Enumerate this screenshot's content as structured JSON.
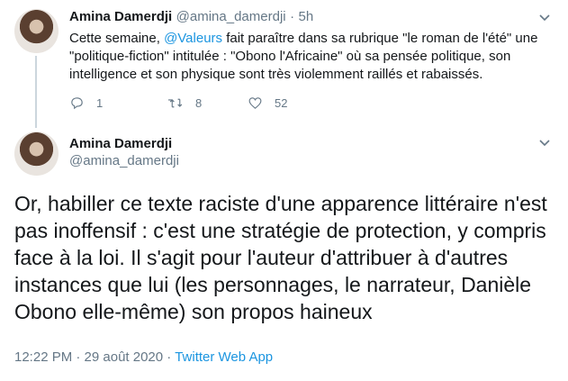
{
  "tweet1": {
    "display_name": "Amina Damerdji",
    "handle": "@amina_damerdji",
    "separator": "·",
    "time": "5h",
    "text_before": "Cette semaine, ",
    "mention": "@Valeurs",
    "text_after": " fait paraître dans sa rubrique \"le roman de l'été\" une \"politique-fiction\" intitulée : \"Obono l'Africaine\" où sa pensée politique, son intelligence et son physique sont très violemment raillés et rabaissés.",
    "replies": "1",
    "retweets": "8",
    "likes": "52",
    "icons": [
      "reply-icon",
      "retweet-icon",
      "like-icon",
      "chevron-down-icon"
    ]
  },
  "tweet2": {
    "display_name": "Amina Damerdji",
    "handle": "@amina_damerdji",
    "text": "Or, habiller ce texte raciste d'une apparence littéraire n'est pas inoffensif : c'est une stratégie de protection, y compris face à la loi. Il s'agit pour l'auteur d'attribuer à d'autres instances que lui (les personnages, le narrateur, Danièle Obono elle-même) son propos haineux",
    "timestamp": "12:22 PM · 29 août 2020 · ",
    "source": "Twitter Web App"
  },
  "colors": {
    "link": "#1b95e0",
    "muted": "#657786",
    "text": "#14171a",
    "thread": "#ccd6dd"
  }
}
